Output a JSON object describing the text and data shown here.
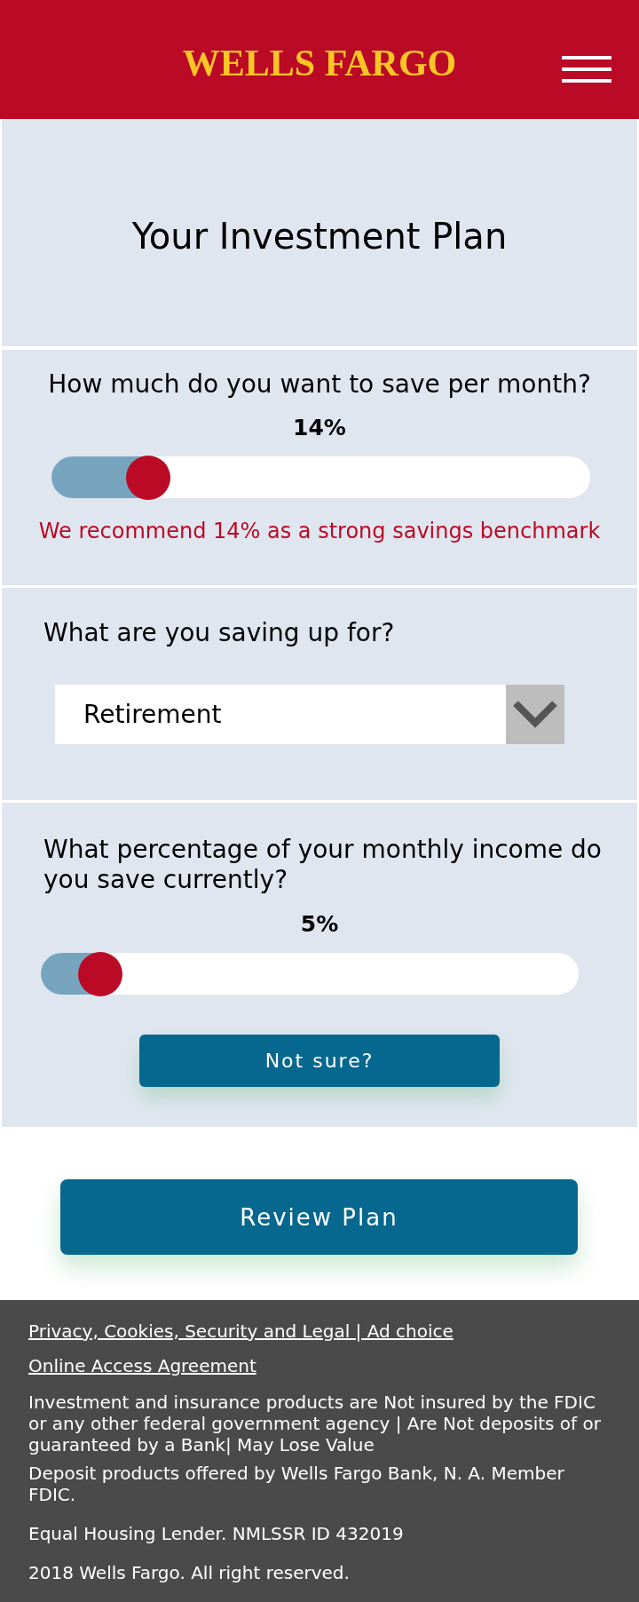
{
  "header": {
    "logo": "WELLS FARGO"
  },
  "title": "Your Investment Plan",
  "questions": [
    {
      "kind": "slider",
      "question": "How much do you want to save per month?",
      "reading": "14%",
      "level": 0.18,
      "note": "We recommend 14% as a strong savings benchmark"
    },
    {
      "kind": "dropdown",
      "question": "What are you saving up for?",
      "value": "Retirement"
    },
    {
      "kind": "slider",
      "question": "What percentage of your monthly income do you save currently?",
      "reading": "5%",
      "level": 0.11,
      "button": "Not sure?"
    }
  ],
  "review_button": "Review Plan",
  "footer": {
    "links": [
      "Privacy, Cookies, Security and Legal | Ad choice",
      "Online Access Agreement"
    ],
    "paragraphs": [
      "Investment and insurance products are Not insured by the FDIC or any other federal government agency | Are Not deposits of or guaranteed by a Bank| May Lose Value",
      "Deposit products offered by Wells Fargo Bank, N. A. Member FDIC.",
      "Equal Housing Lender. NMLSSR ID 432019",
      "2018 Wells Fargo. All right reserved."
    ]
  }
}
